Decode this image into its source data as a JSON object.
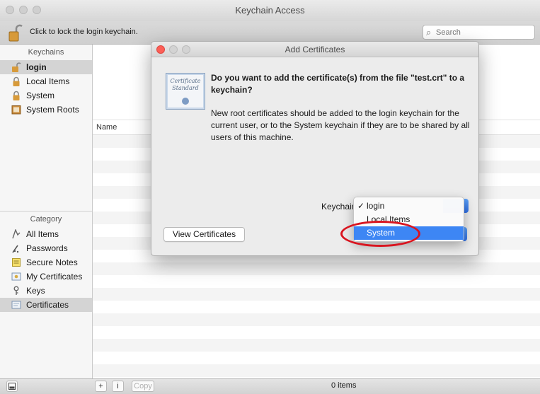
{
  "window": {
    "title": "Keychain Access"
  },
  "toolbar": {
    "lock_text": "Click to lock the login keychain.",
    "search_placeholder": "Search"
  },
  "sidebar": {
    "keychains_header": "Keychains",
    "keychains": [
      {
        "label": "login",
        "icon": "lock-open-icon",
        "selected": true
      },
      {
        "label": "Local Items",
        "icon": "lock-icon",
        "selected": false
      },
      {
        "label": "System",
        "icon": "lock-icon",
        "selected": false
      },
      {
        "label": "System Roots",
        "icon": "cabinet-icon",
        "selected": false
      }
    ],
    "category_header": "Category",
    "categories": [
      {
        "label": "All Items",
        "icon": "all-items-icon",
        "selected": false
      },
      {
        "label": "Passwords",
        "icon": "password-icon",
        "selected": false
      },
      {
        "label": "Secure Notes",
        "icon": "note-icon",
        "selected": false
      },
      {
        "label": "My Certificates",
        "icon": "my-certificates-icon",
        "selected": false
      },
      {
        "label": "Keys",
        "icon": "key-icon",
        "selected": false
      },
      {
        "label": "Certificates",
        "icon": "certificate-icon",
        "selected": true
      }
    ]
  },
  "table": {
    "column_name": "Name"
  },
  "status": {
    "copy_label": "Copy",
    "item_count": "0 items"
  },
  "dialog": {
    "title": "Add Certificates",
    "heading": "Do you want to add the certificate(s) from the file \"test.crt\" to a keychain?",
    "body": "New root certificates should be added to the login keychain for the current user, or to the System keychain if they are to be shared by all users of this machine.",
    "keychain_label": "Keychain:",
    "view_certificates_label": "View Certificates",
    "cert_icon_text": "Certificate Standard",
    "menu": {
      "check_mark": "✓",
      "options": [
        "login",
        "Local Items",
        "System"
      ],
      "selected": "login",
      "highlighted": "System"
    }
  },
  "colors": {
    "accent": "#3d86f4",
    "annotation": "#d9141f"
  }
}
